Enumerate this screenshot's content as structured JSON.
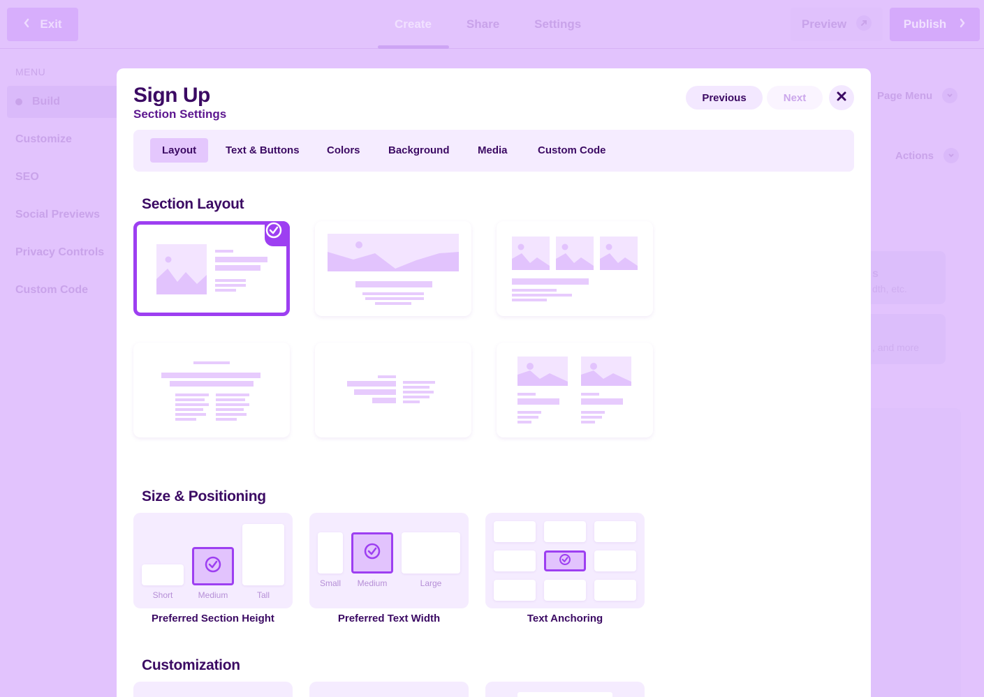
{
  "topbar": {
    "exit_label": "Exit",
    "tabs": [
      {
        "label": "Create",
        "active": true
      },
      {
        "label": "Share",
        "active": false
      },
      {
        "label": "Settings",
        "active": false
      }
    ],
    "preview_label": "Preview",
    "publish_label": "Publish"
  },
  "sidebar": {
    "heading": "MENU",
    "items": [
      {
        "label": "Build",
        "active": true
      },
      {
        "label": "Customize"
      },
      {
        "label": "SEO"
      },
      {
        "label": "Social Previews"
      },
      {
        "label": "Privacy Controls"
      },
      {
        "label": "Custom Code"
      }
    ]
  },
  "right_panel": {
    "page_menu_label": "Page Menu",
    "actions_label": "Actions",
    "card1_partial": "s",
    "card1_sub_partial": "dth, etc.",
    "card2_partial": ", and more"
  },
  "modal": {
    "title": "Sign Up",
    "subtitle": "Section Settings",
    "previous_label": "Previous",
    "next_label": "Next",
    "tabs": [
      {
        "label": "Layout",
        "active": true
      },
      {
        "label": "Text & Buttons"
      },
      {
        "label": "Colors"
      },
      {
        "label": "Background"
      },
      {
        "label": "Media"
      },
      {
        "label": "Custom Code"
      }
    ],
    "section_layout_heading": "Section Layout",
    "size_heading": "Size & Positioning",
    "customization_heading": "Customization",
    "height": {
      "label": "Preferred Section Height",
      "options": [
        "Short",
        "Medium",
        "Tall"
      ],
      "selected": "Medium"
    },
    "width": {
      "label": "Preferred Text Width",
      "options": [
        "Small",
        "Medium",
        "Large"
      ],
      "selected": "Medium"
    },
    "anchoring": {
      "label": "Text Anchoring"
    }
  },
  "colors": {
    "accent": "#9d3ff1",
    "heading": "#3b0a63",
    "overlay": "#e2c3fd",
    "wire": "#e7cbfd"
  }
}
